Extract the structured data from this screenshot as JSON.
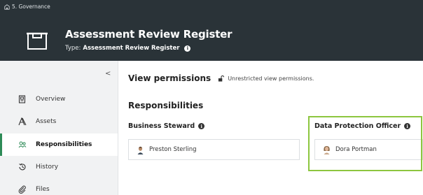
{
  "header": {
    "breadcrumb": "5. Governance",
    "title": "Assessment Review Register",
    "type_label": "Type:",
    "type_value": "Assessment Review Register"
  },
  "sidebar": {
    "collapse_glyph": "<",
    "items": [
      {
        "label": "Overview",
        "icon": "overview-icon"
      },
      {
        "label": "Assets",
        "icon": "assets-icon"
      },
      {
        "label": "Responsibilities",
        "icon": "responsibilities-icon",
        "active": true
      },
      {
        "label": "History",
        "icon": "history-icon"
      },
      {
        "label": "Files",
        "icon": "files-icon"
      }
    ]
  },
  "main": {
    "view_permissions_title": "View permissions",
    "view_permissions_text": "Unrestricted view permissions.",
    "responsibilities_title": "Responsibilities",
    "roles": [
      {
        "name": "Business Steward",
        "person": "Preston Sterling"
      },
      {
        "name": "Data Protection Officer",
        "person": "Dora Portman",
        "highlighted": true
      }
    ]
  },
  "colors": {
    "header_bg": "#2a3338",
    "sidebar_bg": "#f1f2f3",
    "active_accent": "#2e8b57",
    "highlight_border": "#8dc63f"
  }
}
